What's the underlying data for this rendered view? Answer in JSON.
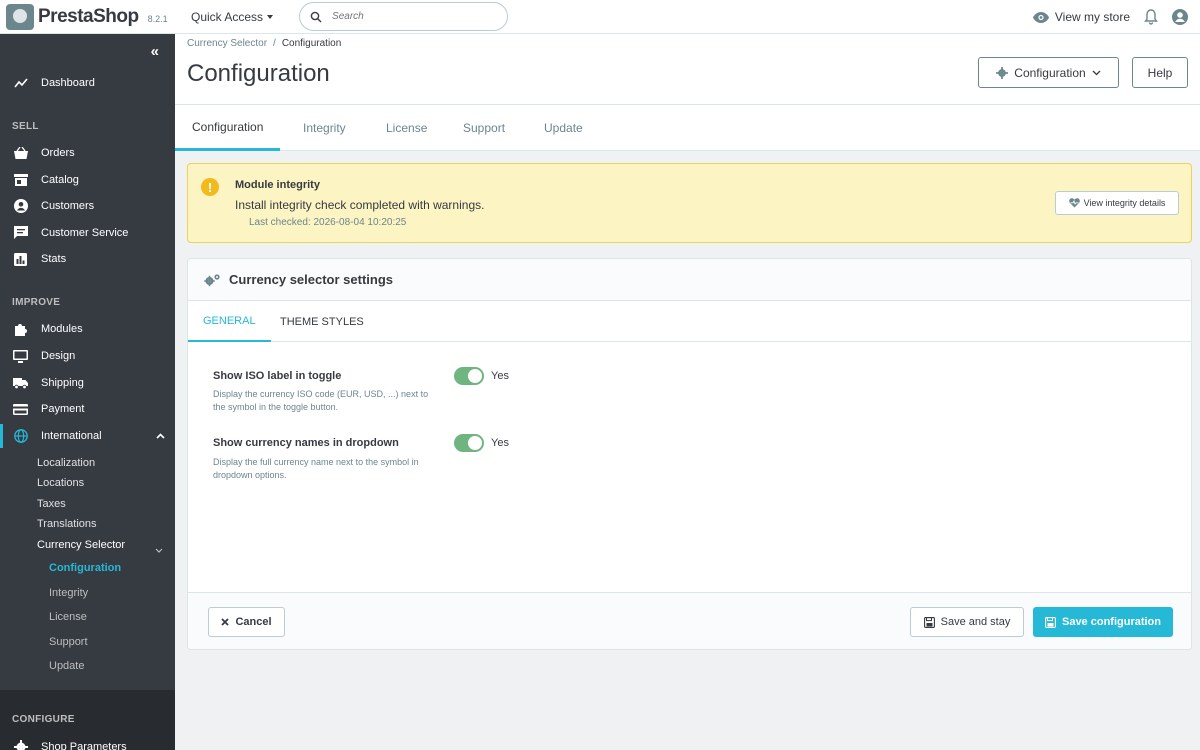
{
  "header": {
    "logo_text": "PrestaShop",
    "version": "8.2.1",
    "quick_access": "Quick Access",
    "search_placeholder": "Search",
    "view_store": "View my store"
  },
  "sidebar": {
    "dashboard": "Dashboard",
    "section_sell": "SELL",
    "orders": "Orders",
    "catalog": "Catalog",
    "customers": "Customers",
    "customer_service": "Customer Service",
    "stats": "Stats",
    "section_improve": "IMPROVE",
    "modules": "Modules",
    "design": "Design",
    "shipping": "Shipping",
    "payment": "Payment",
    "international": "International",
    "sub": [
      "Localization",
      "Locations",
      "Taxes",
      "Translations",
      "Currency Selector"
    ],
    "subsub": [
      "Configuration",
      "Integrity",
      "License",
      "Support",
      "Update"
    ],
    "section_configure": "CONFIGURE",
    "shop_parameters": "Shop Parameters"
  },
  "page": {
    "breadcrumb_parent": "Currency Selector",
    "breadcrumb_current": "Configuration",
    "title": "Configuration",
    "config_button": "Configuration",
    "help_button": "Help"
  },
  "tabs": [
    "Configuration",
    "Integrity",
    "License",
    "Support",
    "Update"
  ],
  "alert": {
    "title": "Module integrity",
    "message": "Install integrity check completed with warnings.",
    "last_checked": "Last checked: 2026-08-04 10:20:25",
    "button": "View integrity details"
  },
  "card": {
    "title": "Currency selector settings",
    "subtabs": [
      "GENERAL",
      "THEME STYLES"
    ],
    "fields": [
      {
        "label": "Show ISO label in toggle",
        "help": "Display the currency ISO code (EUR, USD, ...) next to the symbol in the toggle button.",
        "value": "Yes"
      },
      {
        "label": "Show currency names in dropdown",
        "help": "Display the full currency name next to the symbol in dropdown options.",
        "value": "Yes"
      }
    ],
    "cancel": "Cancel",
    "save_stay": "Save and stay",
    "save": "Save configuration"
  },
  "colors": {
    "accent": "#25b9d7",
    "sidebar": "#363a41",
    "toggle_on": "#70b580",
    "alert_bg": "#fcf4c3"
  }
}
